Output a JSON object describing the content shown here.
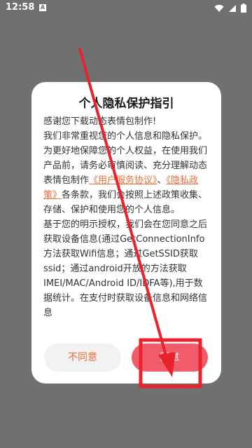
{
  "status_bar": {
    "time": "12:58",
    "notification_icon": "A",
    "icons": [
      "wifi-icon",
      "signal-icon",
      "battery-icon"
    ]
  },
  "dialog": {
    "title": "个人隐私保护指引",
    "body": {
      "p1": "感谢您下载动态表情包制作!",
      "p2_prefix": "我们非常重视您的个人信息和隐私保护。为更好地保障您的个人权益，在使用我们产品前，请务必审慎阅读、充分理解动态表情包制作",
      "link1": "《用户服务协议》",
      "sep": "、",
      "link2": "《隐私政策》",
      "p2_suffix": "各条款，我们会按照上述政策收集、存储、保护和使用您的个人信息。",
      "p3": "基于您的明示授权，我们会在您同意之后获取设备信息(通过GetConnectionInfo方法获取Wifi信息；通过GetSSID获取ssid；通过android开放的方法获取IMEI/MAC/Android ID/IDFA等),用于数据统计。在支付时获取设备信息和网络信息"
    },
    "disagree_label": "不同意",
    "agree_label": "同意"
  },
  "colors": {
    "accent_orange": "#ef6c3b",
    "agree_button": "#f05c6a",
    "annotation_red": "#e8232b",
    "backdrop": "#707070"
  }
}
